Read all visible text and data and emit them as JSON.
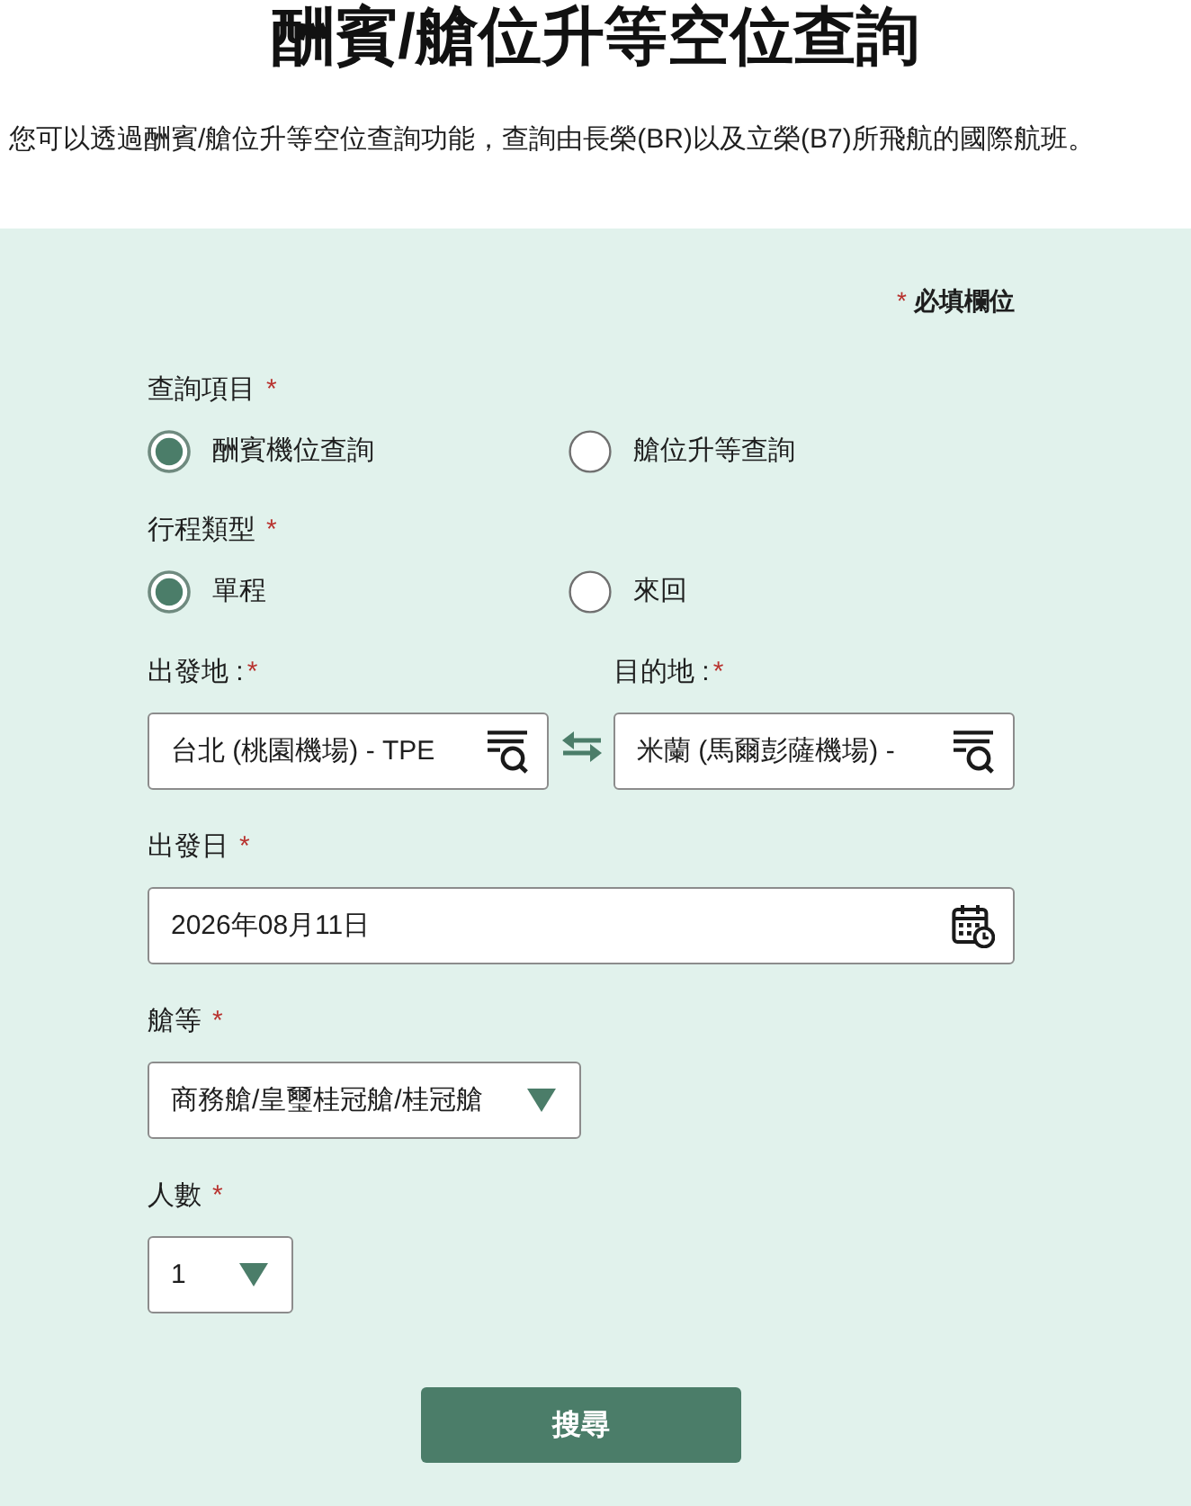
{
  "title": "酬賓/艙位升等空位查詢",
  "intro": "您可以透過酬賓/艙位升等空位查詢功能，查詢由長榮(BR)以及立榮(B7)所飛航的國際航班。",
  "form": {
    "required_note": {
      "mark": "*",
      "text": "必填欄位"
    },
    "query_type": {
      "label": "查詢項目",
      "required_mark": "*",
      "options": [
        {
          "label": "酬賓機位查詢",
          "selected": true
        },
        {
          "label": "艙位升等查詢",
          "selected": false
        }
      ]
    },
    "trip_type": {
      "label": "行程類型",
      "required_mark": "*",
      "options": [
        {
          "label": "單程",
          "selected": true
        },
        {
          "label": "來回",
          "selected": false
        }
      ]
    },
    "origin": {
      "label": "出發地 :",
      "required_mark": "*",
      "value": "台北 (桃園機場) - TPE"
    },
    "destination": {
      "label": "目的地 :",
      "required_mark": "*",
      "value": "米蘭 (馬爾彭薩機場) -"
    },
    "departure_date": {
      "label": "出發日",
      "required_mark": "*",
      "value": "2026年08月11日"
    },
    "cabin_class": {
      "label": "艙等",
      "required_mark": "*",
      "value": "商務艙/皇璽桂冠艙/桂冠艙"
    },
    "passengers": {
      "label": "人數",
      "required_mark": "*",
      "value": "1"
    },
    "search_button": "搜尋"
  }
}
